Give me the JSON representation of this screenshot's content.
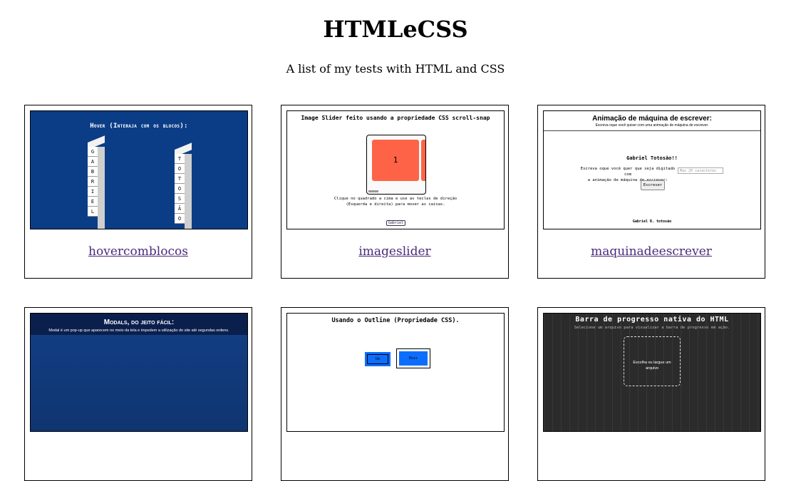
{
  "header": {
    "title": "HTMLeCSS",
    "subtitle": "A list of my tests with HTML and CSS"
  },
  "cards": [
    {
      "link": "hovercomblocos",
      "thumb": {
        "title": "Hover (Interaja com os blocos):",
        "tower1": [
          "G",
          "A",
          "B",
          "R",
          "I",
          "E",
          "L"
        ],
        "tower2": [
          "T",
          "O",
          "T",
          "O",
          "S",
          "Ã",
          "O"
        ]
      }
    },
    {
      "link": "imageslider",
      "thumb": {
        "title": "Image Slider feito usando a propriedade CSS scroll-snap",
        "slide": "1",
        "text_line1": "Clique no quadrado a cima e use as teclas de direção",
        "text_line2": "(Esquerda e direita) para mover as caixas.",
        "credit": "Gabriel"
      }
    },
    {
      "link": "maquinadeescrever",
      "thumb": {
        "title": "Animação de máquina de escrever:",
        "subtitle": "Escreva oque você quiser com uma animação de máquina de escrever.",
        "name": "Gabriel Totosão!!",
        "label_line1": "Escreva oque você quer que seja digitado com",
        "label_line2": "a animação de máquina de escrever:",
        "input_placeholder": "Max 20 caracteres",
        "button": "Escrever",
        "footer": "Gabriel R. totosão"
      }
    },
    {
      "thumb": {
        "title": "Modals, do jeito fácil:",
        "subtitle": "Modal é um pop-up que aparecem no meio da tela e impedem a utilização do site até segundas ordens."
      }
    },
    {
      "thumb": {
        "title": "Usando o Outline (Propriedade CSS).",
        "box1": "Um",
        "box2": "Dois"
      }
    },
    {
      "thumb": {
        "title": "Barra de progresso nativa do HTML",
        "subtitle": "Selecione um arquivo para visualizar a barra de progresso em ação.",
        "drop_line1": "Escolha ou largue um",
        "drop_line2": "arquivo"
      }
    }
  ],
  "colors": {
    "link": "#4b2a7a",
    "hover_bg": "#0b3d87",
    "slide": "#ff6347",
    "outline_blue": "#0d6efd",
    "progress_bg": "#2b2b2b"
  }
}
